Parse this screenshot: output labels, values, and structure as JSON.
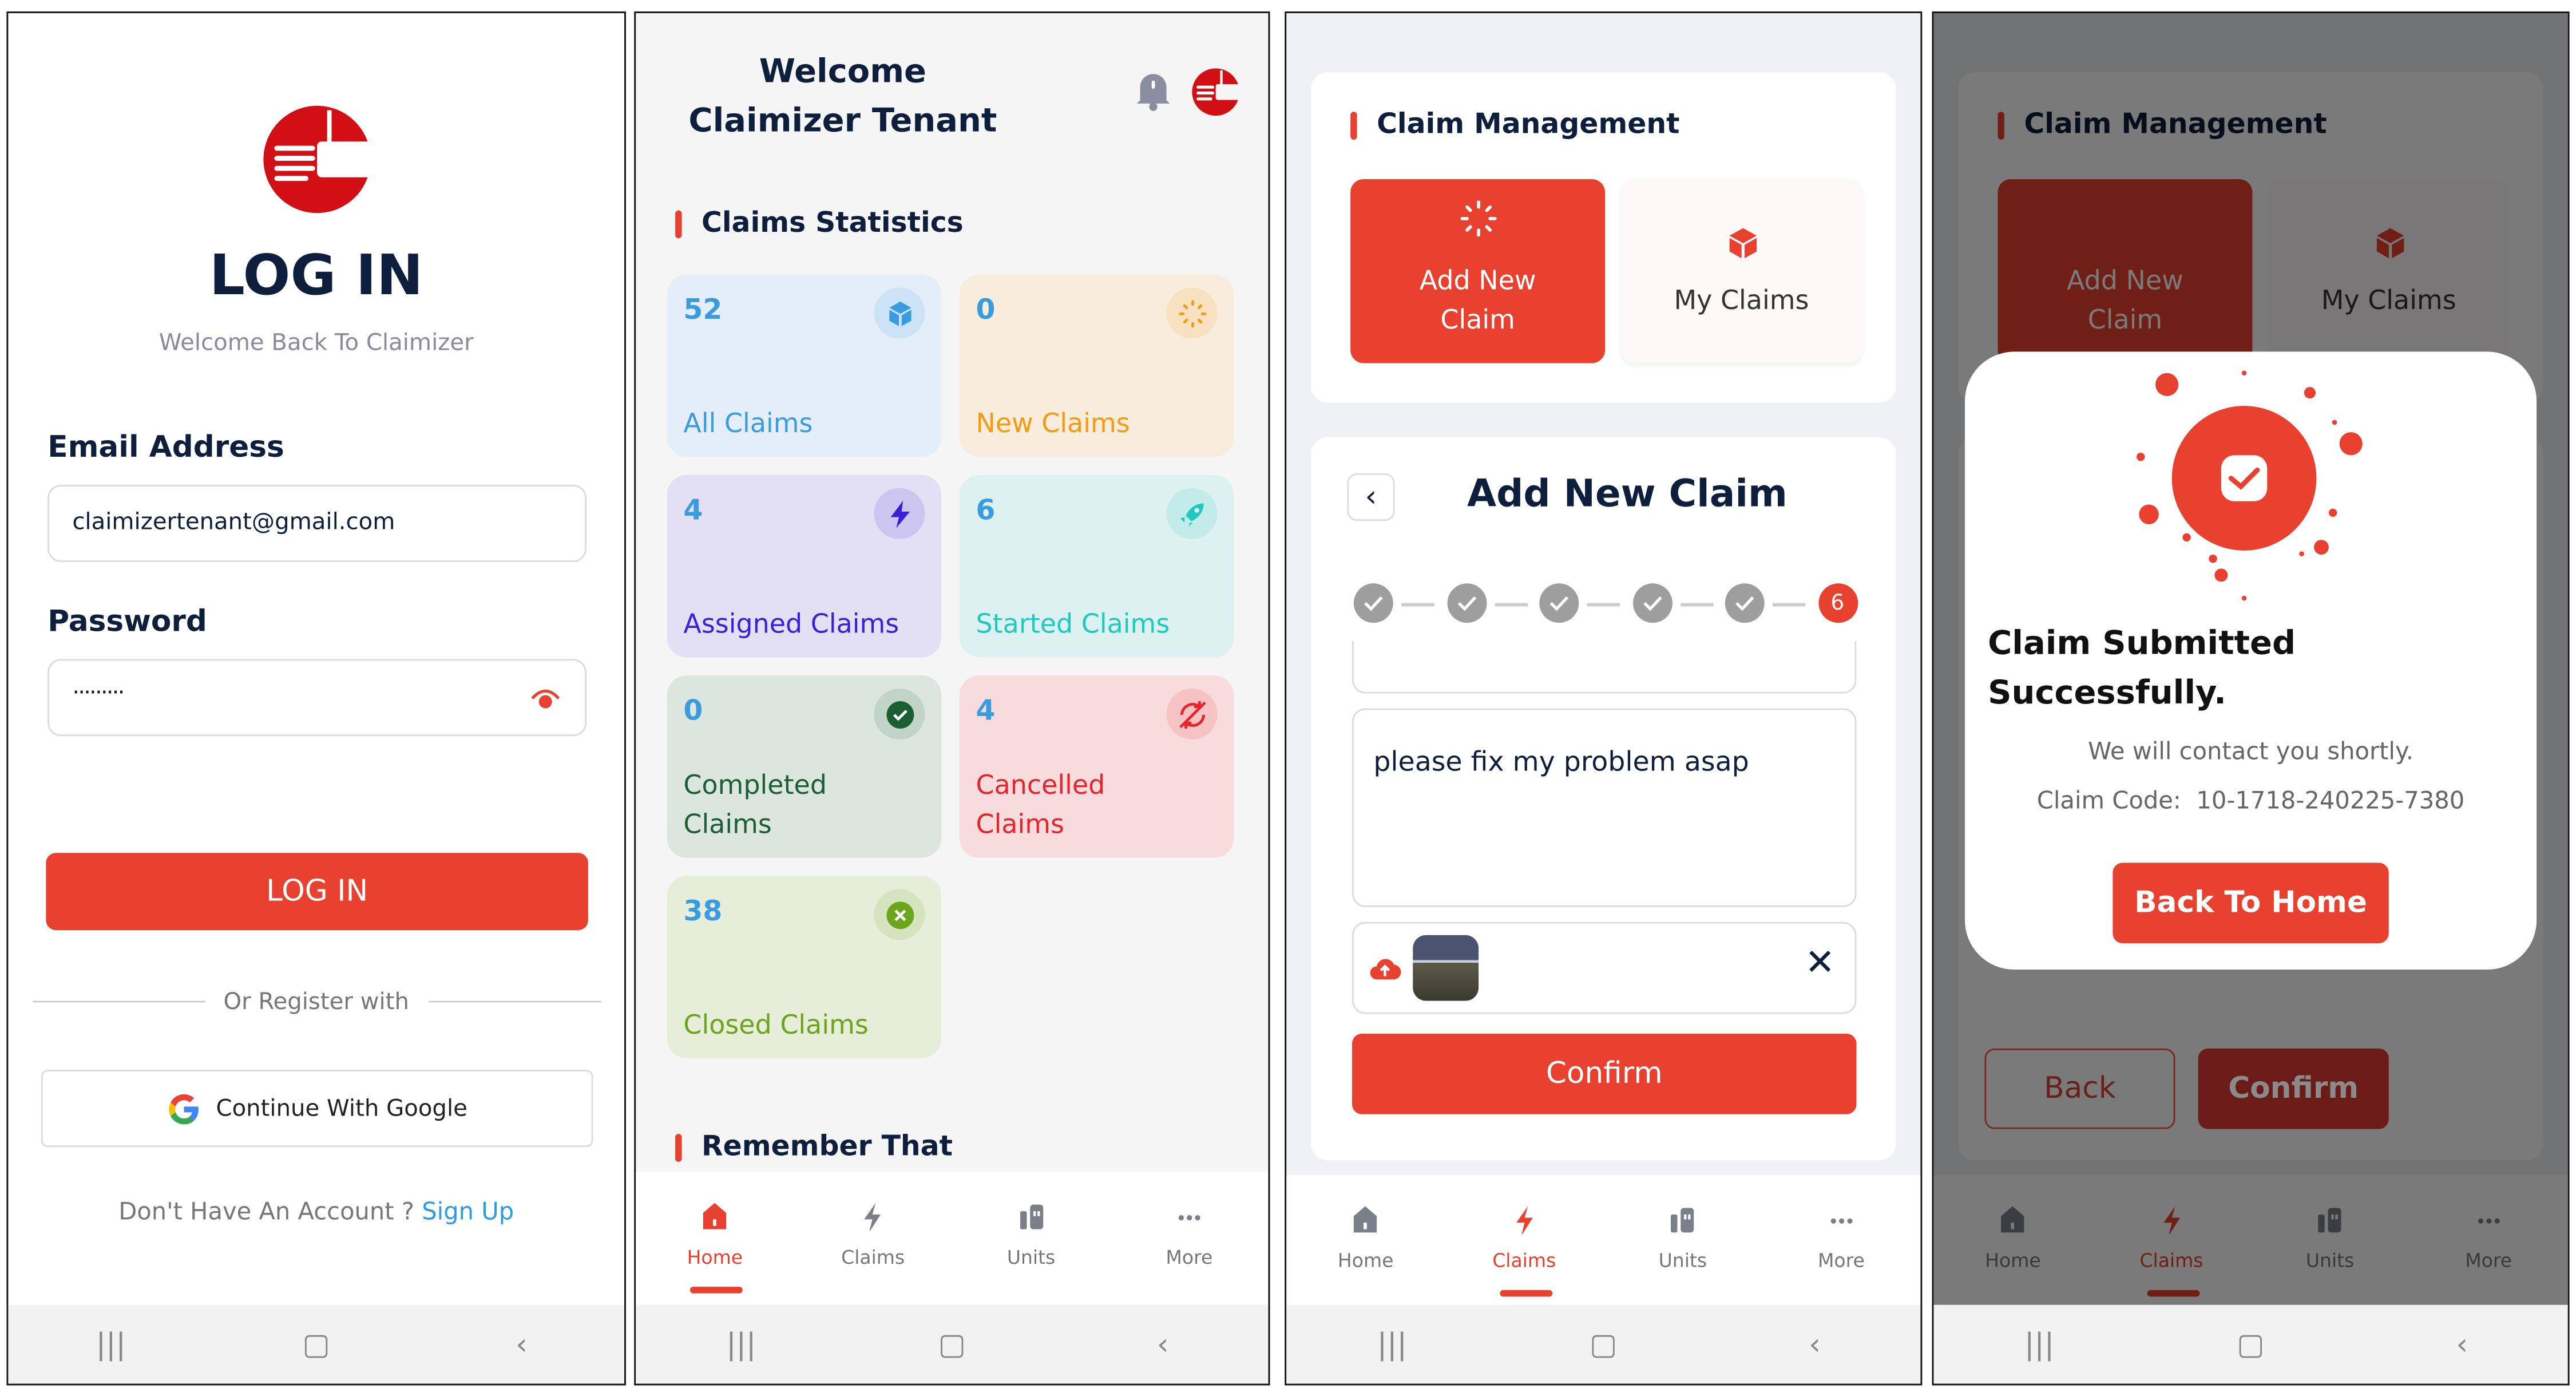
{
  "colors": {
    "accent": "#e8412f",
    "brand_red": "#d20f14",
    "navy": "#0d1f3c"
  },
  "login": {
    "title": "LOG IN",
    "subtitle": "Welcome Back To Claimizer",
    "email_label": "Email Address",
    "email_value": "claimizertenant@gmail.com",
    "password_label": "Password",
    "password_value": "·········",
    "login_button": "LOG IN",
    "divider_text": "Or Register with",
    "google_button": "Continue With Google",
    "no_account": "Don't Have An Account ?",
    "sign_up": "Sign Up"
  },
  "home": {
    "welcome_line1": "Welcome",
    "welcome_line2": "Claimizer Tenant",
    "stats_title": "Claims Statistics",
    "cards": [
      {
        "count": "52",
        "label": "All Claims",
        "icon": "cube-icon",
        "bg": "#e3eef8",
        "fg": "#3a9be0"
      },
      {
        "count": "0",
        "label": "New Claims",
        "icon": "loader-icon",
        "bg": "#f8ecdd",
        "fg": "#f39c12"
      },
      {
        "count": "4",
        "label": "Assigned Claims",
        "icon": "bolt-icon",
        "bg": "#e3dff4",
        "fg": "#3b1fd6"
      },
      {
        "count": "6",
        "label": "Started Claims",
        "icon": "rocket-icon",
        "bg": "#ddf1f0",
        "fg": "#1ec9c0"
      },
      {
        "count": "0",
        "label": "Completed Claims",
        "icon": "check-circle-icon",
        "bg": "#dce5de",
        "fg": "#1c5e34"
      },
      {
        "count": "4",
        "label": "Cancelled Claims",
        "icon": "sync-off-icon",
        "bg": "#f8dcdd",
        "fg": "#e8242a"
      },
      {
        "count": "38",
        "label": "Closed Claims",
        "icon": "x-circle-icon",
        "bg": "#e6edd9",
        "fg": "#6aa51a"
      }
    ],
    "remember_title": "Remember That"
  },
  "bottom_nav": [
    "Home",
    "Claims",
    "Units",
    "More"
  ],
  "claim_mgmt": {
    "title": "Claim Management",
    "add_tile": "Add New Claim",
    "my_claims_tile": "My Claims"
  },
  "add_claim": {
    "title": "Add New Claim",
    "steps_total": 6,
    "current_step": "6",
    "description": "please fix my problem asap",
    "confirm": "Confirm"
  },
  "success": {
    "title": "Claim Submitted Successfully.",
    "message": "We will contact you shortly.",
    "code_label": "Claim Code:",
    "code": "10-1718-240225-7380",
    "home_button": "Back To Home",
    "back": "Back",
    "confirm": "Confirm"
  }
}
